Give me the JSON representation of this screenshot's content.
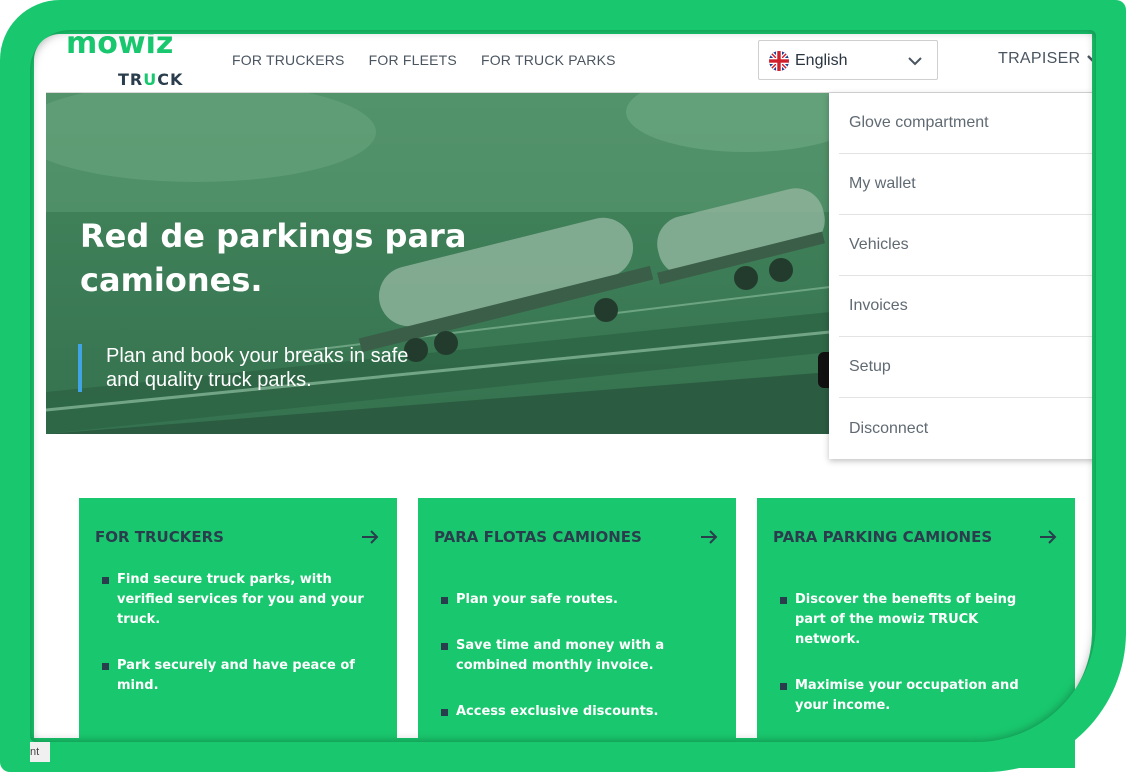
{
  "logo": {
    "brand": "mowiz",
    "product_prefix": "TR",
    "product_u": "U",
    "product_suffix": "CK"
  },
  "nav": {
    "items": [
      "FOR TRUCKERS",
      "FOR FLEETS",
      "FOR TRUCK PARKS"
    ]
  },
  "language": {
    "selected": "English",
    "flag_icon": "uk-flag-icon"
  },
  "user": {
    "name": "TRAPISER"
  },
  "dropdown": {
    "items": [
      "Glove compartment",
      "My wallet",
      "Vehicles",
      "Invoices",
      "Setup",
      "Disconnect"
    ]
  },
  "hero": {
    "title": "Red de parkings para camiones.",
    "subtitle": "Plan and book your breaks in safe and quality truck parks."
  },
  "cards": [
    {
      "title": "FOR TRUCKERS",
      "bullets": [
        "Find secure truck parks, with verified services for you and your truck.",
        "Park securely and have peace of mind."
      ]
    },
    {
      "title": "PARA FLOTAS CAMIONES",
      "bullets": [
        "Plan your safe routes.",
        "Save time and money with a combined monthly invoice.",
        "Access exclusive discounts."
      ]
    },
    {
      "title": "PARA PARKING CAMIONES",
      "bullets": [
        "Discover the benefits of being part of the mowiz TRUCK network.",
        "Maximise your occupation and your income."
      ]
    }
  ],
  "corner_tag": "nt",
  "colors": {
    "brand_green": "#19c86e",
    "dark_navy": "#2a3d4d",
    "accent_blue": "#3fa3e6"
  }
}
